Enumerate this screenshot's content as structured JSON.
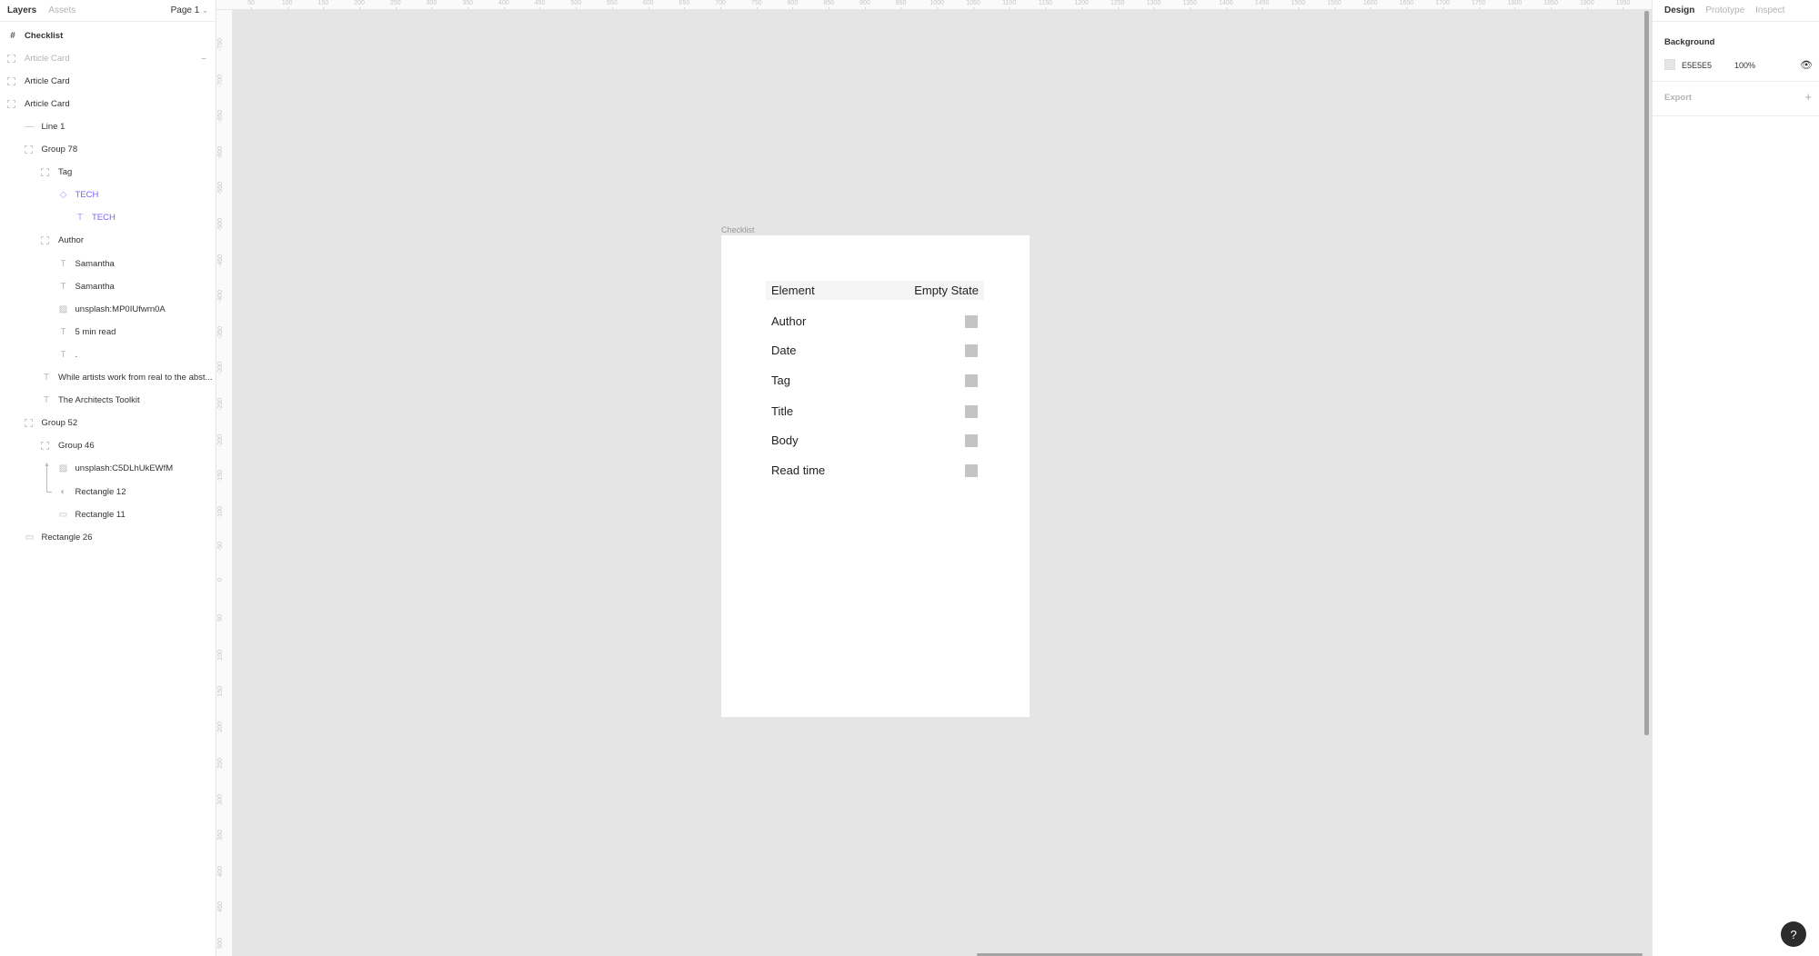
{
  "left_panel": {
    "tabs": [
      "Layers",
      "Assets"
    ],
    "page_selector": "Page 1",
    "layers": [
      {
        "name": "Checklist",
        "icon": "frame-icon",
        "indent": 0,
        "style": "bold"
      },
      {
        "name": "Article Card",
        "icon": "group-icon",
        "indent": 0,
        "style": "hidden"
      },
      {
        "name": "Article Card",
        "icon": "group-icon",
        "indent": 0,
        "style": "normal"
      },
      {
        "name": "Article Card",
        "icon": "group-icon",
        "indent": 0,
        "style": "normal"
      },
      {
        "name": "Line 1",
        "icon": "line-icon",
        "indent": 1,
        "style": "normal"
      },
      {
        "name": "Group 78",
        "icon": "group-icon",
        "indent": 1,
        "style": "normal"
      },
      {
        "name": "Tag",
        "icon": "group-icon",
        "indent": 2,
        "style": "normal"
      },
      {
        "name": "TECH",
        "icon": "component-instance-icon",
        "indent": 3,
        "style": "purple"
      },
      {
        "name": "TECH",
        "icon": "text-icon",
        "indent": 4,
        "style": "purple"
      },
      {
        "name": "Author",
        "icon": "group-icon",
        "indent": 2,
        "style": "normal"
      },
      {
        "name": "Samantha",
        "icon": "text-icon",
        "indent": 3,
        "style": "normal"
      },
      {
        "name": "Samantha",
        "icon": "text-icon",
        "indent": 3,
        "style": "normal"
      },
      {
        "name": "unsplash:MP0IUfwrn0A",
        "icon": "image-icon",
        "indent": 3,
        "style": "normal"
      },
      {
        "name": "5 min read",
        "icon": "text-icon",
        "indent": 3,
        "style": "normal"
      },
      {
        "name": ".",
        "icon": "text-icon",
        "indent": 3,
        "style": "normal"
      },
      {
        "name": "While artists work from real to the abst...",
        "icon": "text-icon",
        "indent": 2,
        "style": "normal"
      },
      {
        "name": "The Architects Toolkit",
        "icon": "text-icon",
        "indent": 2,
        "style": "normal"
      },
      {
        "name": "Group 52",
        "icon": "group-icon",
        "indent": 1,
        "style": "normal"
      },
      {
        "name": "Group 46",
        "icon": "group-icon",
        "indent": 2,
        "style": "normal"
      },
      {
        "name": "unsplash:C5DLhUkEWfM",
        "icon": "image-icon",
        "indent": 3,
        "style": "normal"
      },
      {
        "name": "Rectangle 12",
        "icon": "mask-icon",
        "indent": 3,
        "style": "normal"
      },
      {
        "name": "Rectangle 11",
        "icon": "rectangle-icon",
        "indent": 3,
        "style": "normal"
      },
      {
        "name": "Rectangle 26",
        "icon": "rectangle-icon",
        "indent": 1,
        "style": "normal"
      }
    ]
  },
  "rulers": {
    "horizontal": [
      "50",
      "100",
      "150",
      "200",
      "250",
      "300",
      "350",
      "400",
      "450",
      "500",
      "550",
      "600",
      "650",
      "700",
      "750",
      "800",
      "850",
      "900",
      "950",
      "1000",
      "1050",
      "1100",
      "1150",
      "1200",
      "1250",
      "1300",
      "1350",
      "1400",
      "1450",
      "1500",
      "1550",
      "1600",
      "1650",
      "1700",
      "1750",
      "1800",
      "1850",
      "1900",
      "1950"
    ],
    "vertical": [
      "-750",
      "-700",
      "-650",
      "-600",
      "-550",
      "-500",
      "-450",
      "-400",
      "-350",
      "-300",
      "-250",
      "-200",
      "-150",
      "-100",
      "-50",
      "0",
      "50",
      "100",
      "150",
      "200",
      "250",
      "300",
      "350",
      "400",
      "450",
      "500"
    ]
  },
  "canvas": {
    "frame_label": "Checklist",
    "table": {
      "headers": [
        "Element",
        "Empty State"
      ],
      "rows": [
        {
          "element": "Author",
          "checked": false
        },
        {
          "element": "Date",
          "checked": false
        },
        {
          "element": "Tag",
          "checked": false
        },
        {
          "element": "Title",
          "checked": false
        },
        {
          "element": "Body",
          "checked": false
        },
        {
          "element": "Read time",
          "checked": false
        }
      ]
    }
  },
  "right_panel": {
    "tabs": [
      "Design",
      "Prototype",
      "Inspect"
    ],
    "background": {
      "title": "Background",
      "hex": "E5E5E5",
      "opacity": "100%",
      "color": "#e5e5e5"
    },
    "export": {
      "title": "Export"
    }
  },
  "help": {
    "label": "?"
  },
  "colors": {
    "accent": "#7b61ff",
    "canvas": "#e5e5e5"
  }
}
